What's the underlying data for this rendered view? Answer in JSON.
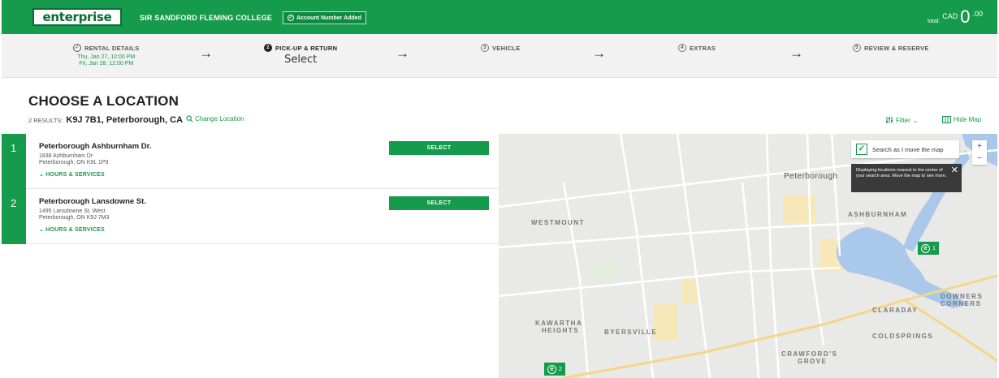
{
  "header": {
    "logo_text": "enterprise",
    "org_name": "SIR SANDFORD FLEMING COLLEGE",
    "account_badge": "Account Number Added",
    "total_label": "total:",
    "total_currency": "CAD",
    "total_amount": "0",
    "total_decimal": ".00"
  },
  "steps": [
    {
      "title": "RENTAL DETAILS",
      "line1": "Thu, Jan 27, 12:00 PM",
      "line2": "Fri, Jan 28, 12:00 PM"
    },
    {
      "title": "PICK-UP & RETURN",
      "value": "Select"
    },
    {
      "title": "VEHICLE"
    },
    {
      "title": "EXTRAS"
    },
    {
      "title": "REVIEW & RESERVE"
    }
  ],
  "page": {
    "title": "CHOOSE A LOCATION",
    "results_prefix": "2 RESULTS:",
    "results_query": "K9J 7B1, Peterborough, CA",
    "change_location": "Change Location",
    "filter_label": "Filter",
    "hide_map_label": "Hide Map"
  },
  "locations": [
    {
      "num": "1",
      "name": "Peterborough Ashburnham Dr.",
      "addr1": "1838 Ashburnham Dr",
      "addr2": "Peterborough, ON K9L 1P9",
      "hours": "HOURS & SERVICES",
      "select": "SELECT"
    },
    {
      "num": "2",
      "name": "Peterborough Lansdowne St.",
      "addr1": "1495 Lansdowne St. West",
      "addr2": "Peterborough, ON K9J 7M3",
      "hours": "HOURS & SERVICES",
      "select": "SELECT"
    }
  ],
  "map": {
    "search_label": "Search as I move the map",
    "tooltip": "Displaying locations nearest to the center of your search area. Move the map to see more.",
    "labels": {
      "peterborough": "Peterborough",
      "westmount": "WESTMOUNT",
      "ashburnham": "ASHBURNHAM",
      "downers": "DOWNERS",
      "corners": "CORNERS",
      "claraday": "CLARADAY",
      "coldsprings": "COLDSPRINGS",
      "kawartha": "KAWARTHA",
      "heights": "HEIGHTS",
      "byersville": "BYERSVILLE",
      "crawfords": "CRAWFORD'S",
      "grove": "GROVE"
    },
    "pins": [
      {
        "num": "1"
      },
      {
        "num": "2"
      }
    ]
  },
  "colors": {
    "brand": "#169a4b",
    "brand_dark": "#0c6b34",
    "water": "#aac8ea",
    "park": "#f6e8b9"
  }
}
